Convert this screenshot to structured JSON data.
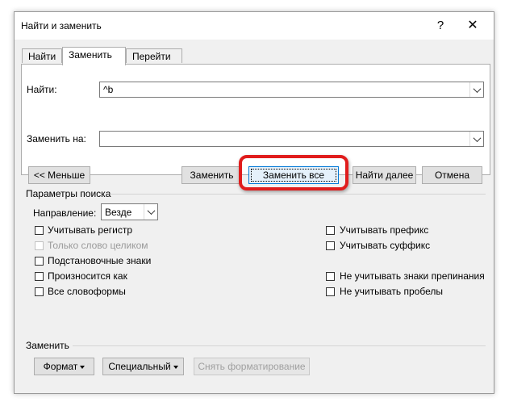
{
  "window": {
    "title": "Найти и заменить",
    "help_glyph": "?",
    "close_glyph": "✕"
  },
  "tabs": [
    {
      "label": "Найти",
      "active": false
    },
    {
      "label": "Заменить",
      "active": true
    },
    {
      "label": "Перейти",
      "active": false
    }
  ],
  "find": {
    "label": "Найти:",
    "value": "^b"
  },
  "replace": {
    "label": "Заменить на:",
    "value": ""
  },
  "buttons": {
    "less": "<< Меньше",
    "replace": "Заменить",
    "replace_all": "Заменить все",
    "find_next": "Найти далее",
    "cancel": "Отмена"
  },
  "search_options": {
    "title": "Параметры поиска",
    "direction_label": "Направление:",
    "direction_value": "Везде",
    "left": [
      {
        "label": "Учитывать регистр",
        "checked": false,
        "enabled": true
      },
      {
        "label": "Только слово целиком",
        "checked": false,
        "enabled": false
      },
      {
        "label": "Подстановочные знаки",
        "checked": false,
        "enabled": true
      },
      {
        "label": "Произносится как",
        "checked": false,
        "enabled": true
      },
      {
        "label": "Все словоформы",
        "checked": false,
        "enabled": true
      }
    ],
    "right": [
      {
        "label": "Учитывать префикс",
        "checked": false,
        "enabled": true
      },
      {
        "label": "Учитывать суффикс",
        "checked": false,
        "enabled": true
      },
      {
        "label": "Не учитывать знаки препинания",
        "checked": false,
        "enabled": true
      },
      {
        "label": "Не учитывать пробелы",
        "checked": false,
        "enabled": true
      }
    ]
  },
  "replace_section": {
    "title": "Заменить",
    "format_button": "Формат",
    "special_button": "Специальный",
    "no_formatting_button": "Снять форматирование"
  },
  "colors": {
    "highlight": "#e01c1c",
    "primary_border": "#0078d7"
  }
}
